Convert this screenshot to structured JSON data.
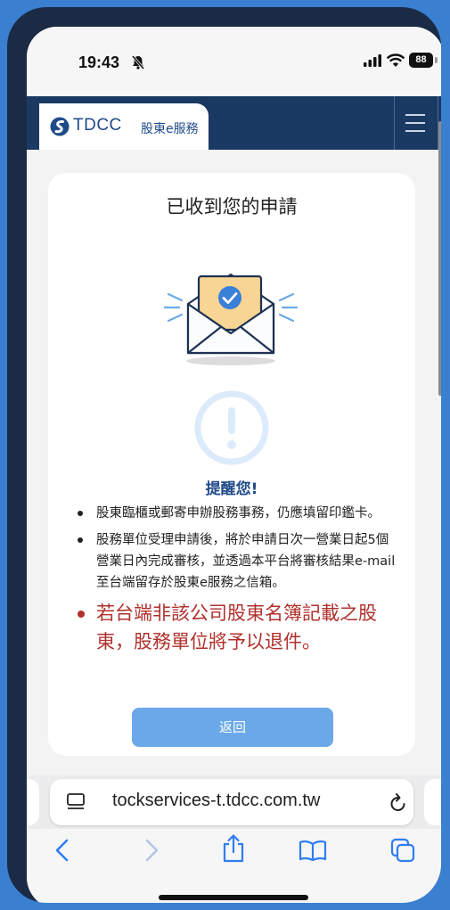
{
  "status_bar": {
    "time": "19:43",
    "battery": "88"
  },
  "header": {
    "logo_text": "TDCC",
    "logo_subtitle": "股東e服務"
  },
  "card": {
    "title": "已收到您的申請",
    "reminder_title": "提醒您!",
    "notes": [
      "股東臨櫃或郵寄申辦股務事務，仍應填留印鑑卡。",
      "股務單位受理申請後，將於申請日次一營業日起5個營業日內完成審核，並透過本平台將審核結果e-mail至台端留存於股東e服務之信箱。"
    ],
    "warning_note": "若台端非該公司股東名簿記載之股東，股務單位將予以退件。",
    "back_button": "返回"
  },
  "browser": {
    "url": "tockservices-t.tdcc.com.tw"
  },
  "colors": {
    "header_bg": "#1a3a63",
    "brand_blue": "#1f4a8a",
    "warning_red": "#b0302c",
    "button_blue": "#6aa8e8"
  }
}
